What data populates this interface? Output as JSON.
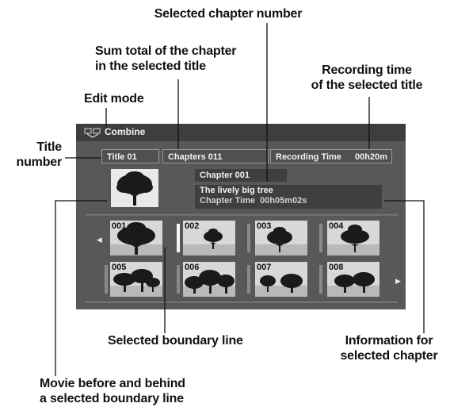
{
  "callouts": {
    "selected_chapter_number": "Selected chapter number",
    "sum_total_line1": "Sum total of the chapter",
    "sum_total_line2": "in the selected title",
    "recording_time_line1": "Recording time",
    "recording_time_line2": "of the selected title",
    "edit_mode": "Edit mode",
    "title_number_line1": "Title",
    "title_number_line2": "number",
    "selected_boundary_line": "Selected boundary line",
    "info_for_chapter_line1": "Information for",
    "info_for_chapter_line2": "selected chapter",
    "movie_before_line1": "Movie before and behind",
    "movie_before_line2": "a selected boundary line"
  },
  "screen": {
    "mode_label": "Combine",
    "mode_icon": "edit-mode-icon",
    "title_field": "Title 01",
    "chapters_field": "Chapters 011",
    "recording_time_label": "Recording Time",
    "recording_time_value": "00h20m",
    "chapter_number": "Chapter 001",
    "chapter_title": "The lively big tree",
    "chapter_time_label": "Chapter Time",
    "chapter_time_value": "00h05m02s",
    "thumbnails": [
      "001",
      "002",
      "003",
      "004",
      "005",
      "006",
      "007",
      "008"
    ],
    "selected_boundary_after": "001",
    "nav_left_icon": "triangle-left-icon",
    "nav_right_icon": "triangle-right-icon",
    "colors": {
      "panel": "#58585a",
      "mode_bar": "#3e3e40",
      "selected_line": "#f5f5f5"
    }
  }
}
